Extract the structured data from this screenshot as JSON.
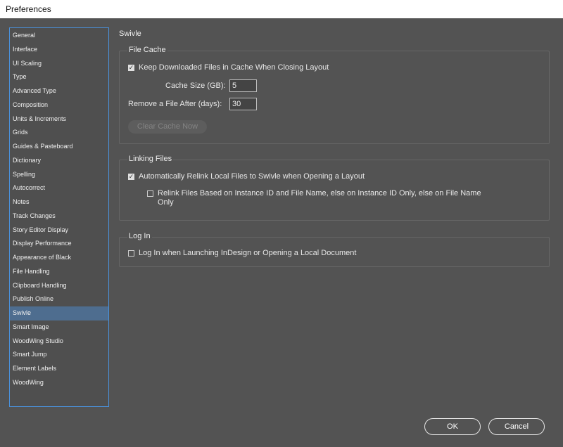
{
  "window": {
    "title": "Preferences"
  },
  "sidebar": {
    "items": [
      "General",
      "Interface",
      "UI Scaling",
      "Type",
      "Advanced Type",
      "Composition",
      "Units & Increments",
      "Grids",
      "Guides & Pasteboard",
      "Dictionary",
      "Spelling",
      "Autocorrect",
      "Notes",
      "Track Changes",
      "Story Editor Display",
      "Display Performance",
      "Appearance of Black",
      "File Handling",
      "Clipboard Handling",
      "Publish Online",
      "Swivle",
      "Smart Image",
      "WoodWing Studio",
      "Smart Jump",
      "Element Labels",
      "WoodWing"
    ],
    "selected": "Swivle"
  },
  "page": {
    "title": "Swivle"
  },
  "file_cache": {
    "legend": "File Cache",
    "keep_downloaded_label": "Keep Downloaded Files in Cache When Closing Layout",
    "keep_downloaded_checked": true,
    "cache_size_label": "Cache Size (GB):",
    "cache_size_value": "5",
    "remove_after_label": "Remove a File After (days):",
    "remove_after_value": "30",
    "clear_cache_label": "Clear Cache Now"
  },
  "linking_files": {
    "legend": "Linking Files",
    "auto_relink_label": "Automatically Relink Local Files to Swivle when Opening a Layout",
    "auto_relink_checked": true,
    "relink_instance_label": "Relink Files Based on Instance ID and File Name, else on Instance ID Only, else on File Name Only",
    "relink_instance_checked": false
  },
  "log_in": {
    "legend": "Log In",
    "login_label": "Log In when Launching InDesign or Opening a Local Document",
    "login_checked": false
  },
  "buttons": {
    "ok": "OK",
    "cancel": "Cancel"
  }
}
